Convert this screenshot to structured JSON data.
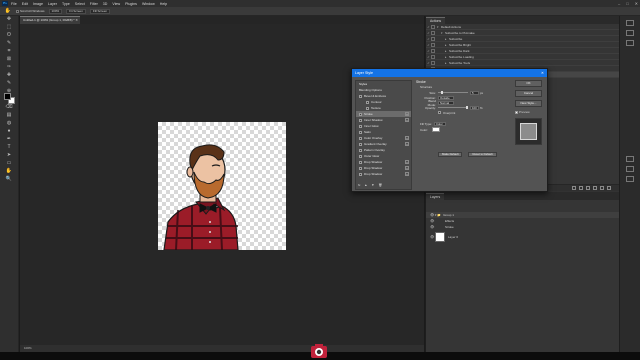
{
  "menubar": {
    "app_icon": "Ps",
    "items": [
      "File",
      "Edit",
      "Image",
      "Layer",
      "Type",
      "Select",
      "Filter",
      "3D",
      "View",
      "Plugins",
      "Window",
      "Help"
    ],
    "window_controls": [
      "–",
      "□",
      "✕"
    ]
  },
  "options": {
    "items": [
      "Scroll All Windows",
      "100%",
      "Fit Screen",
      "Fill Screen"
    ]
  },
  "document": {
    "tab_title": "Untitled-1 @ 100% (Group 1, RGB/8) * ✕"
  },
  "tools": {
    "icons": [
      "move-icon",
      "marquee-icon",
      "lasso-icon",
      "quick-select-icon",
      "crop-icon",
      "frame-icon",
      "eyedropper-icon",
      "healing-icon",
      "brush-icon",
      "stamp-icon",
      "history-brush-icon",
      "eraser-icon",
      "gradient-icon",
      "blur-icon",
      "dodge-icon",
      "pen-icon",
      "type-icon",
      "path-select-icon",
      "shape-icon",
      "hand-icon",
      "zoom-icon"
    ],
    "glyphs": [
      "✥",
      "⬚",
      "ʘ",
      "✎",
      "⌗",
      "⊠",
      "✑",
      "✚",
      "✎",
      "⊕",
      "↺",
      "⌫",
      "▤",
      "◍",
      "●",
      "✒",
      "T",
      "➤",
      "▭",
      "✋",
      "🔍"
    ],
    "foreground": "#000000",
    "background": "#ffffff"
  },
  "canvas": {
    "alt": "Illustrated man with beard, plaid shirt and bow tie"
  },
  "statusbar": {
    "zoom": "100%"
  },
  "actions_panel": {
    "tab": "Actions",
    "rows": [
      {
        "label": "Default Actions",
        "level": 0,
        "expanded": true
      },
      {
        "label": "Subscribe to Piximake",
        "level": 1,
        "expanded": true
      },
      {
        "label": "Subscribe",
        "level": 2
      },
      {
        "label": "Subscribe Bright",
        "level": 2
      },
      {
        "label": "Subscribe Dark",
        "level": 2
      },
      {
        "label": "Subscribe Loading",
        "level": 2
      },
      {
        "label": "Subscribe Tools",
        "level": 2
      },
      {
        "label": "Subscribe Tools",
        "level": 2
      },
      {
        "label": "Blend With ... Layer 1",
        "level": 2,
        "selected": true
      }
    ]
  },
  "layers_panel": {
    "tab": "Layers",
    "rows": [
      {
        "label": "Group 1",
        "type": "group"
      },
      {
        "label": "Effects",
        "type": "fx"
      },
      {
        "label": "Stroke",
        "type": "fx"
      },
      {
        "label": "Layer 0",
        "type": "layer"
      }
    ]
  },
  "dialog": {
    "title": "Layer Style",
    "close": "✕",
    "styles_header": "Styles",
    "styles": [
      {
        "label": "Blending Options",
        "checkbox": false,
        "plus": false,
        "indent": 0
      },
      {
        "label": "Bevel & Emboss",
        "checkbox": true,
        "plus": false,
        "indent": 0
      },
      {
        "label": "Contour",
        "checkbox": true,
        "plus": false,
        "indent": 1
      },
      {
        "label": "Texture",
        "checkbox": true,
        "plus": false,
        "indent": 1
      },
      {
        "label": "Stroke",
        "checkbox": true,
        "plus": true,
        "indent": 0,
        "selected": true
      },
      {
        "label": "Inner Shadow",
        "checkbox": true,
        "plus": true,
        "indent": 0
      },
      {
        "label": "Inner Glow",
        "checkbox": true,
        "plus": false,
        "indent": 0
      },
      {
        "label": "Satin",
        "checkbox": true,
        "plus": false,
        "indent": 0
      },
      {
        "label": "Color Overlay",
        "checkbox": true,
        "plus": true,
        "indent": 0
      },
      {
        "label": "Gradient Overlay",
        "checkbox": true,
        "plus": true,
        "indent": 0
      },
      {
        "label": "Pattern Overlay",
        "checkbox": true,
        "plus": false,
        "indent": 0
      },
      {
        "label": "Outer Glow",
        "checkbox": true,
        "plus": false,
        "indent": 0
      },
      {
        "label": "Drop Shadow",
        "checkbox": true,
        "plus": true,
        "indent": 0
      },
      {
        "label": "Drop Shadow",
        "checkbox": true,
        "plus": true,
        "indent": 0
      },
      {
        "label": "Drop Shadow",
        "checkbox": true,
        "plus": true,
        "indent": 0
      }
    ],
    "footer_icons": [
      "fx",
      "▲",
      "▼",
      "🗑"
    ],
    "section_title": "Stroke",
    "structure_label": "Structure",
    "size": {
      "label": "Size:",
      "value": "5",
      "unit": "px",
      "fraction": 0.1
    },
    "position": {
      "label": "Position:",
      "value": "Outside"
    },
    "blend_mode": {
      "label": "Blend Mode:",
      "value": "Normal"
    },
    "opacity": {
      "label": "Opacity:",
      "value": "100",
      "unit": "%",
      "fraction": 1.0
    },
    "overprint": {
      "label": "Overprint"
    },
    "fill_type": {
      "label": "Fill Type:",
      "value": "Color"
    },
    "color": {
      "label": "Color:",
      "value": "#ffffff"
    },
    "make_default": "Make Default",
    "reset_default": "Reset to Default",
    "buttons": {
      "ok": "OK",
      "cancel": "Cancel",
      "new_style": "New Style...",
      "preview": "Preview"
    },
    "accent": "#1473e6"
  }
}
